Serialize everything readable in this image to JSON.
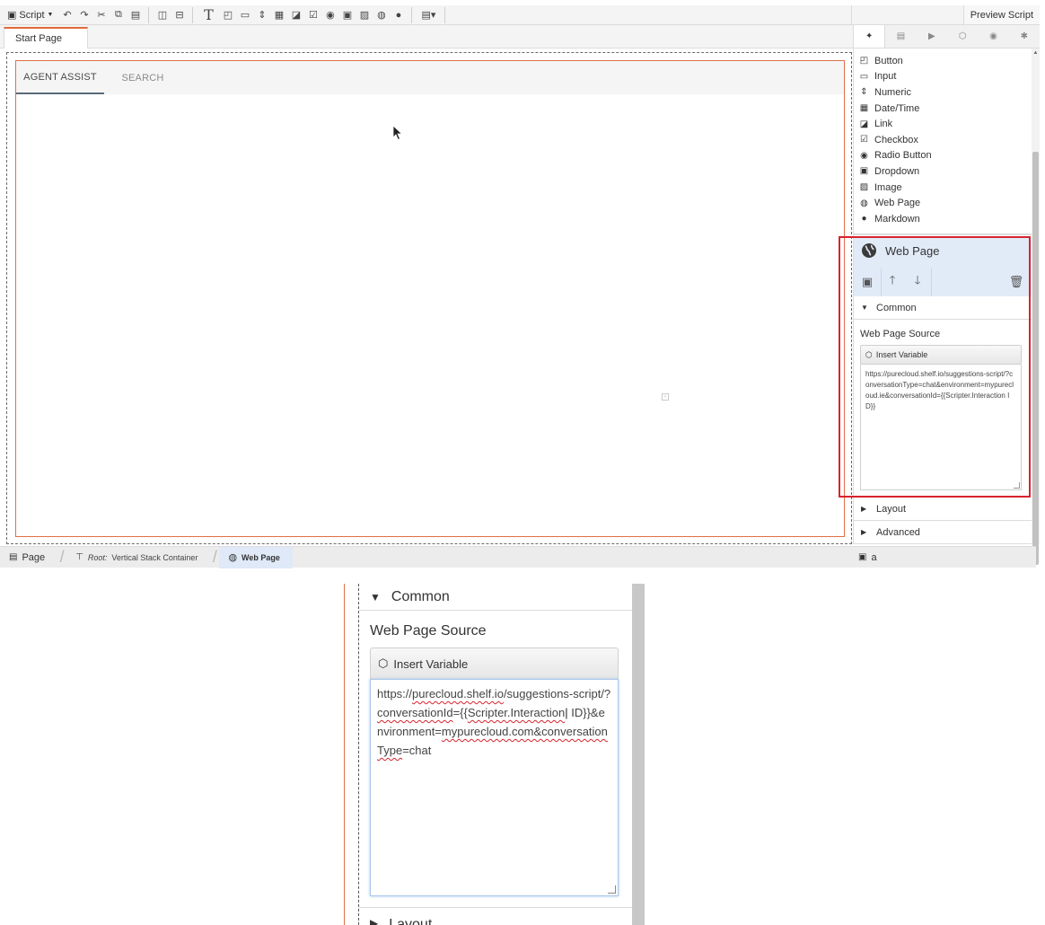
{
  "toolbar": {
    "script_label": "Script",
    "script_icon": "script-icon",
    "preview_label": "Preview Script",
    "text_glyph": "T"
  },
  "page_tab": {
    "label": "Start Page"
  },
  "canvas": {
    "tabs": [
      {
        "label": "AGENT ASSIST",
        "active": true
      },
      {
        "label": "SEARCH",
        "active": false
      }
    ]
  },
  "right_panel": {
    "tab_icons": [
      "pin-icon",
      "page-icon",
      "play-icon",
      "cube-icon",
      "eye-icon",
      "bug-icon"
    ],
    "components": [
      {
        "label": "Button",
        "icon": "button-icon"
      },
      {
        "label": "Input",
        "icon": "input-icon"
      },
      {
        "label": "Numeric",
        "icon": "numeric-icon"
      },
      {
        "label": "Date/Time",
        "icon": "calendar-icon"
      },
      {
        "label": "Link",
        "icon": "link-icon"
      },
      {
        "label": "Checkbox",
        "icon": "checkbox-icon"
      },
      {
        "label": "Radio Button",
        "icon": "radio-icon"
      },
      {
        "label": "Dropdown",
        "icon": "dropdown-icon"
      },
      {
        "label": "Image",
        "icon": "image-icon"
      },
      {
        "label": "Web Page",
        "icon": "globe-icon"
      },
      {
        "label": "Markdown",
        "icon": "markdown-icon"
      }
    ],
    "selected": {
      "title": "Web Page",
      "sections": {
        "common": "Common",
        "layout": "Layout",
        "advanced": "Advanced"
      },
      "field_label": "Web Page Source",
      "insert_variable": "Insert Variable",
      "source_value": "https://purecloud.shelf.io/suggestions-script/?conversationType=chat&environment=mypurecloud.ie&conversationId={{Scripter.Interaction ID}}"
    },
    "status_text": "a"
  },
  "breadcrumb": {
    "page": "Page",
    "root_prefix": "Root:",
    "root_label": "Vertical Stack Container",
    "current": "Web Page"
  },
  "zoom": {
    "common": "Common",
    "field_label": "Web Page Source",
    "insert_variable": "Insert Variable",
    "source_parts": {
      "p1": "https://",
      "p2": "purecloud.shelf.io",
      "p3": "/suggestions-script/?",
      "p4": "conversationId",
      "p5": "={{",
      "p6": "Scripter.Interaction",
      "p7": " ID}}&environment=",
      "p8": "mypurecloud.com&conversationType",
      "p9": "=chat"
    },
    "layout": "Layout"
  },
  "colors": {
    "accent_orange": "#e06b3b",
    "highlight_red": "#d9232f",
    "selected_blue": "#e1ebf8"
  }
}
